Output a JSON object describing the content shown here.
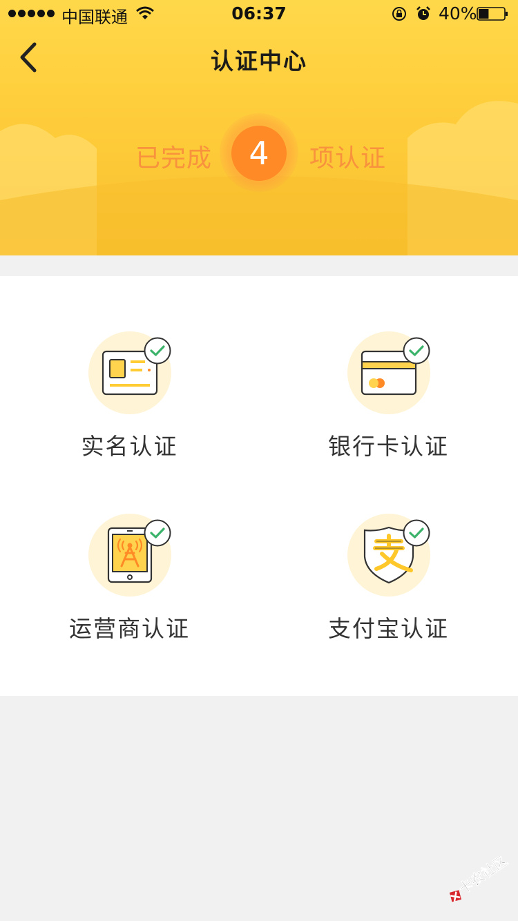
{
  "status_bar": {
    "carrier": "中国联通",
    "time": "06:37",
    "battery": "40%",
    "battery_level": 0.4
  },
  "nav": {
    "title": "认证中心",
    "back_icon": "chevron-left-icon"
  },
  "summary": {
    "prefix": "已完成",
    "count": "4",
    "suffix": "项认证"
  },
  "verifications": [
    {
      "label": "实名认证",
      "icon": "id-card-icon",
      "status": "verified"
    },
    {
      "label": "银行卡认证",
      "icon": "bank-card-icon",
      "status": "verified"
    },
    {
      "label": "运营商认证",
      "icon": "carrier-phone-icon",
      "status": "verified"
    },
    {
      "label": "支付宝认证",
      "icon": "alipay-shield-icon",
      "status": "verified"
    }
  ],
  "watermark": "卡农社区",
  "colors": {
    "header_yellow": "#ffd84a",
    "accent_orange": "#f8923d",
    "badge_orange": "#ff8a26",
    "check_green": "#3bb36b",
    "icon_circle": "#fff4d6"
  }
}
